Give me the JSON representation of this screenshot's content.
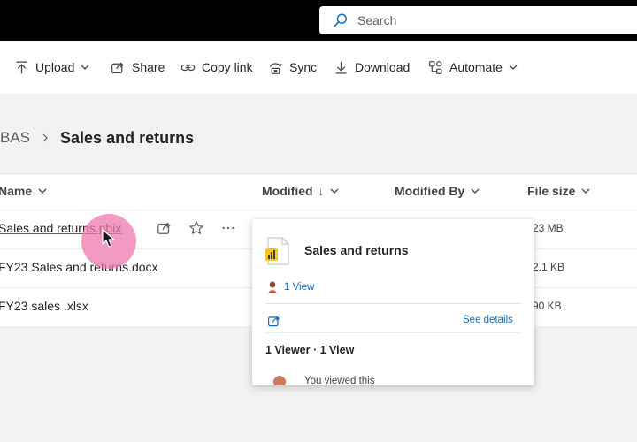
{
  "search": {
    "placeholder": "Search"
  },
  "commands": [
    {
      "label": "Upload",
      "icon": "upload-icon",
      "has_dropdown": true
    },
    {
      "label": "Share",
      "icon": "share-icon"
    },
    {
      "label": "Copy link",
      "icon": "link-icon"
    },
    {
      "label": "Sync",
      "icon": "sync-icon"
    },
    {
      "label": "Download",
      "icon": "download-icon"
    },
    {
      "label": "Automate",
      "icon": "automate-icon",
      "has_dropdown": true
    }
  ],
  "breadcrumb": {
    "parent": "BAS",
    "current": "Sales and returns"
  },
  "columns": {
    "name": "Name",
    "modified": "Modified",
    "modified_sort": "↓",
    "modified_by": "Modified By",
    "file_size": "File size"
  },
  "files": [
    {
      "name": "Sales and returns.pbix",
      "size": "23 MB"
    },
    {
      "name": "FY23 Sales and returns.docx",
      "size": "2.1 KB"
    },
    {
      "name": "FY23 sales .xlsx",
      "size": "90 KB"
    }
  ],
  "hover_card": {
    "title": "Sales and returns",
    "views": "1 View",
    "see_details": "See details",
    "summary": "1 Viewer · 1 View",
    "activity": "You viewed this"
  },
  "colors": {
    "accent": "#0f6cbd",
    "topbar": "#000000",
    "powerbi": "#f2c811",
    "cursor_halo": "#ef78af"
  }
}
